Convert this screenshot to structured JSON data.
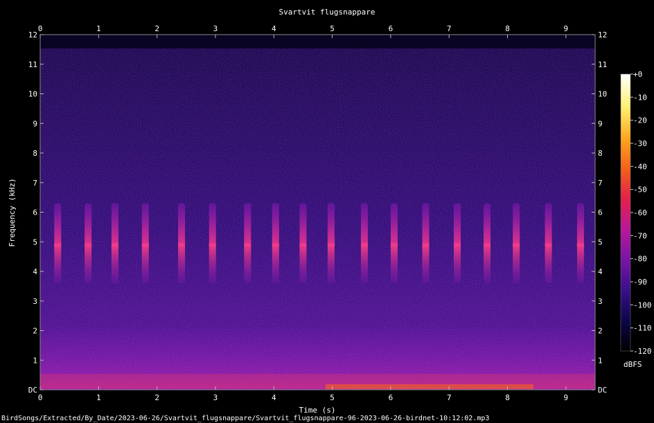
{
  "chart_data": {
    "type": "heatmap",
    "title": "Svartvit flugsnappare",
    "xlabel": "Time (s)",
    "ylabel": "Frequency (kHz)",
    "xlim": [
      0,
      9.5
    ],
    "ylim": [
      0,
      12
    ],
    "x_ticks": [
      "0",
      "1",
      "2",
      "3",
      "4",
      "5",
      "6",
      "7",
      "8",
      "9"
    ],
    "y_ticks": [
      "DC",
      "1",
      "2",
      "3",
      "4",
      "5",
      "6",
      "7",
      "8",
      "9",
      "10",
      "11",
      "12"
    ],
    "colorbar": {
      "label": "dBFS",
      "range": [
        -120,
        0
      ],
      "ticks": [
        "+0",
        "-10",
        "-20",
        "-30",
        "-40",
        "-50",
        "-60",
        "-70",
        "-80",
        "-90",
        "-100",
        "-110",
        "-120"
      ],
      "colors": [
        "#000000",
        "#0c0648",
        "#3a0f8a",
        "#7a14a8",
        "#b8189a",
        "#e3204a",
        "#f4621a",
        "#fca820",
        "#fff070",
        "#ffffff"
      ]
    },
    "calls": {
      "unit_x": "s",
      "unit_y": "kHz",
      "freq_range_khz": [
        3.6,
        6.3
      ],
      "times_s": [
        0.3,
        0.82,
        1.28,
        1.8,
        2.42,
        2.95,
        3.55,
        4.03,
        4.5,
        4.98,
        5.55,
        6.06,
        6.6,
        7.14,
        7.65,
        8.15,
        8.7,
        9.25
      ]
    },
    "caption": "BirdSongs/Extracted/By_Date/2023-06-26/Svartvit_flugsnappare/Svartvit_flugsnappare-96-2023-06-26-birdnet-10:12:02.mp3"
  }
}
